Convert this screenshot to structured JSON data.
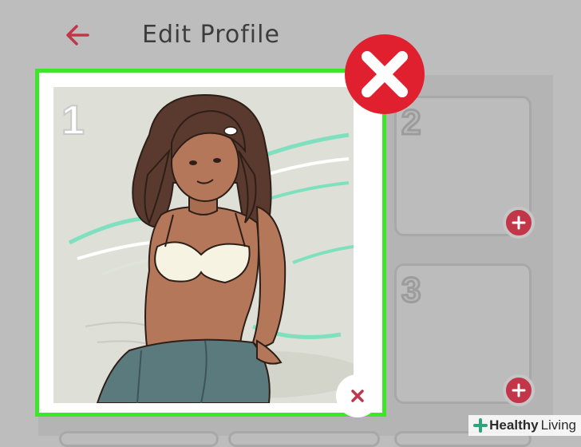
{
  "header": {
    "title": "Edit Profile",
    "back_icon": "arrow-left-icon"
  },
  "photos": [
    {
      "number": "1",
      "state": "filled",
      "remove_icon": "close-icon"
    },
    {
      "number": "2",
      "state": "empty",
      "add_icon": "plus-icon"
    },
    {
      "number": "3",
      "state": "empty",
      "add_icon": "plus-icon"
    }
  ],
  "overlay": {
    "reject_icon": "red-x-icon"
  },
  "watermark": {
    "brand_bold": "Healthy",
    "brand_light": "Living"
  },
  "colors": {
    "accent": "#c2364a",
    "highlight_border": "#3ee52a",
    "reject_red": "#e0202f"
  }
}
